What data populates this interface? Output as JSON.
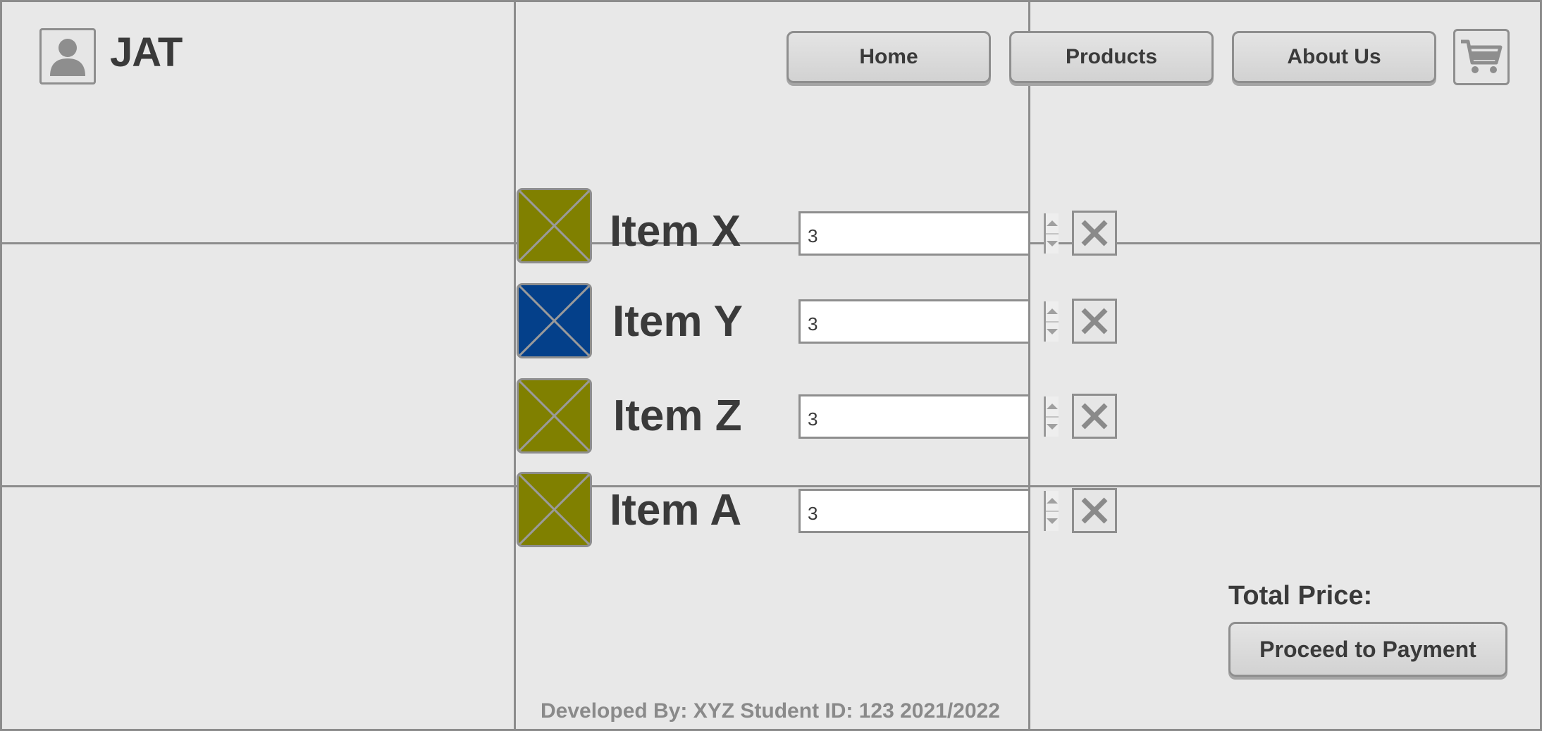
{
  "header": {
    "logo_text": "JAT",
    "avatar_icon": "user-avatar-icon",
    "cart_icon": "cart-icon"
  },
  "nav": {
    "home": "Home",
    "products": "Products",
    "about": "About Us"
  },
  "cart": {
    "items": [
      {
        "name": "Item X",
        "quantity": "3",
        "thumb_color": "#808000"
      },
      {
        "name": "Item Y",
        "quantity": "3",
        "thumb_color": "#04408a"
      },
      {
        "name": "Item Z",
        "quantity": "3",
        "thumb_color": "#808000"
      },
      {
        "name": "Item A",
        "quantity": "3",
        "thumb_color": "#808000"
      }
    ],
    "total_label": "Total Price:",
    "proceed_label": "Proceed to Payment"
  },
  "footer": {
    "text": "Developed By: XYZ Student ID: 123 2021/2022"
  },
  "colors": {
    "background": "#e8e8e8",
    "border": "#8c8c8c",
    "text": "#3a3a3a",
    "muted_text": "#8a8a8a"
  }
}
